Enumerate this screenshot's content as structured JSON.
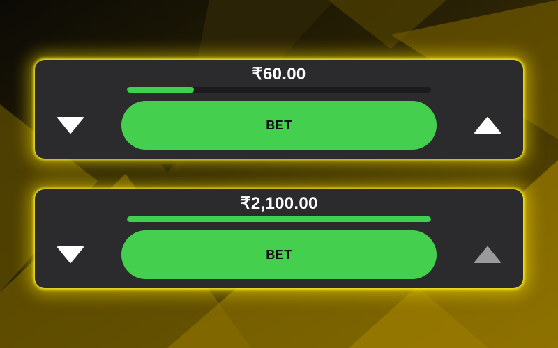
{
  "colors": {
    "accent_green": "#44cf4e",
    "glow_yellow": "#ffe600",
    "panel_bg": "#2b2b2d",
    "arrow_active": "#ffffff",
    "arrow_disabled": "#9a9a9a"
  },
  "bet_panels": [
    {
      "amount": "₹60.00",
      "progress_fraction": 0.22,
      "button_label": "BET",
      "decrease_icon": "triangle-down-icon",
      "increase_icon": "triangle-up-icon",
      "increase_enabled": true
    },
    {
      "amount": "₹2,100.00",
      "progress_fraction": 1.0,
      "button_label": "BET",
      "decrease_icon": "triangle-down-icon",
      "increase_icon": "triangle-up-icon",
      "increase_enabled": false
    }
  ]
}
